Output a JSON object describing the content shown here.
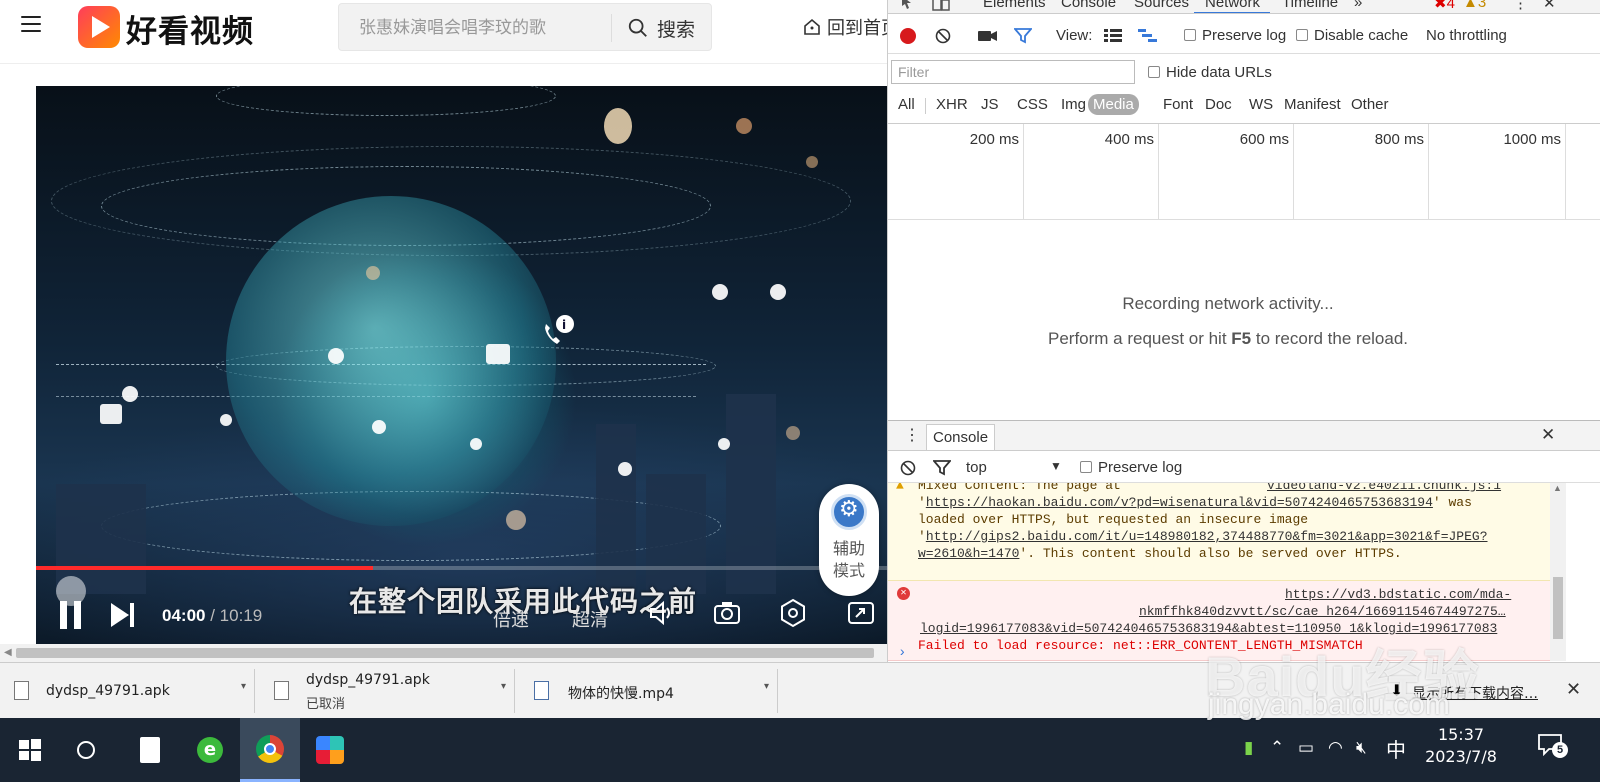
{
  "site": {
    "logo_text": "好看视频",
    "search_placeholder": "张惠妹演唱会唱李玟的歌",
    "search_button": "搜索",
    "home_link": "回到首页"
  },
  "video": {
    "subtitle": "在整个团队采用此代码之前",
    "current_time": "04:00",
    "separator": " / ",
    "total_time": "10:19",
    "progress": 0.39,
    "speed_label": "倍速",
    "quality_label": "超清",
    "assist_label": "辅助\n模式"
  },
  "devtools": {
    "tabs": [
      "Elements",
      "Console",
      "Sources",
      "Network",
      "Timeline"
    ],
    "active_tab": "Network",
    "overflow": "»",
    "error_count": "4",
    "warning_count": "3",
    "view_label": "View:",
    "preserve_log": "Preserve log",
    "disable_cache": "Disable cache",
    "throttling": "No throttling",
    "filter_placeholder": "Filter",
    "hide_data_urls": "Hide data URLs",
    "type_filters": [
      "All",
      "XHR",
      "JS",
      "CSS",
      "Img",
      "Media",
      "Font",
      "Doc",
      "WS",
      "Manifest",
      "Other"
    ],
    "active_type": "Media",
    "timeline_ticks": [
      "200 ms",
      "400 ms",
      "600 ms",
      "800 ms",
      "1000 ms"
    ],
    "empty_title": "Recording network activity...",
    "empty_hint_pre": "Perform a request or hit ",
    "empty_hint_key": "F5",
    "empty_hint_post": " to record the reload."
  },
  "console": {
    "tab_label": "Console",
    "context": "top",
    "preserve_log": "Preserve log",
    "warning": {
      "line0": "Mixed Content: The page at",
      "source": "videoland-v2.e40211.chunk.js:1",
      "line1_url": "https://haokan.baidu.com/v?pd=wisenatural&vid=5074240465753683194",
      "line1_post": "' was",
      "line2": "loaded over HTTPS, but requested an insecure image",
      "line3_url": "http://gips2.baidu.com/it/u=148980182,374488770&fm=3021&app=3021&f=JPEG?",
      "line4_url": "w=2610&h=1470",
      "line4_post": "'. This content should also be served over HTTPS."
    },
    "error": {
      "line1_url": "https://vd3.bdstatic.com/mda-",
      "line2_url": "nkmffhk840dzvvtt/sc/cae_h264/16691154674497275…",
      "line3_url": "logid=1996177083&vid=5074240465753683194&abtest=110950_1&klogid=1996177083",
      "line4": "Failed to load resource: net::ERR_CONTENT_LENGTH_MISMATCH"
    },
    "prompt": "›"
  },
  "downloads": {
    "items": [
      {
        "name": "dydsp_49791.apk",
        "status": ""
      },
      {
        "name": "dydsp_49791.apk",
        "status": "已取消"
      },
      {
        "name": "物体的快慢.mp4",
        "status": ""
      }
    ],
    "show_all": "显示所有下载内容…",
    "close": "✕"
  },
  "taskbar": {
    "time": "15:37",
    "date": "2023/7/8",
    "ime": "中",
    "notifications": "5"
  },
  "watermark": {
    "brand": "Baidu经验",
    "url": "jingyan.baidu.com"
  },
  "colors": {
    "progress_red": "#ff2a2a",
    "devtools_accent": "#3879d9",
    "record_red": "#d7191c",
    "taskbar_bg": "#1a2533"
  }
}
